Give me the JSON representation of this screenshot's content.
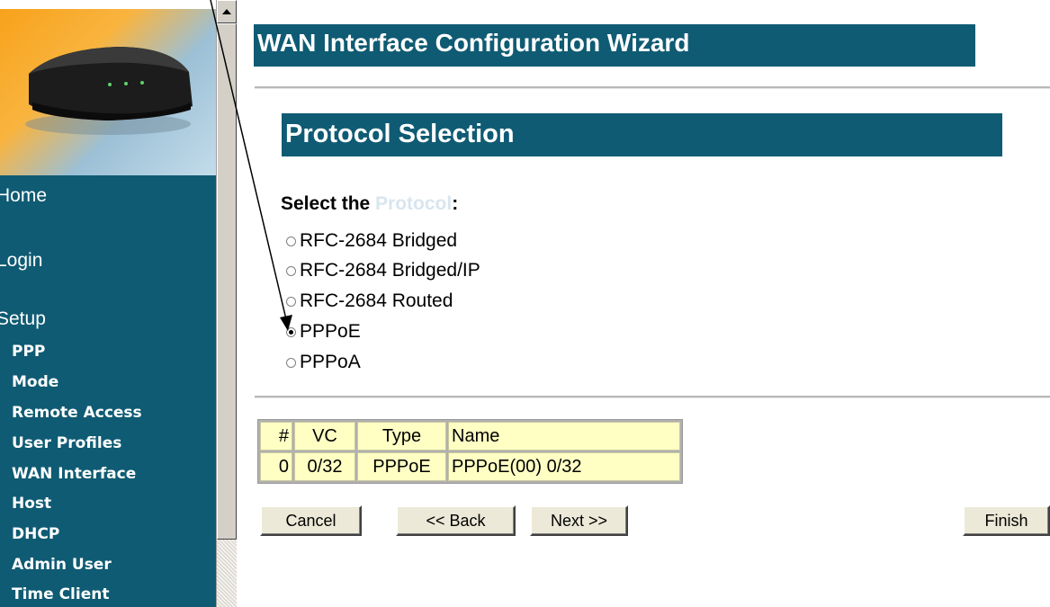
{
  "sidebar": {
    "main_items": [
      {
        "label": "Home"
      },
      {
        "label": "Login"
      },
      {
        "label": "Setup"
      }
    ],
    "sub_items": [
      {
        "label": "PPP"
      },
      {
        "label": "Mode"
      },
      {
        "label": "Remote Access"
      },
      {
        "label": "User Profiles"
      },
      {
        "label": "WAN Interface"
      },
      {
        "label": "Host"
      },
      {
        "label": "DHCP"
      },
      {
        "label": "Admin User"
      },
      {
        "label": "Time Client"
      }
    ]
  },
  "main": {
    "wizard_title": "WAN Interface Configuration Wizard",
    "section_title": "Protocol Selection",
    "prompt": {
      "prefix": "Select the ",
      "highlight": "Protocol",
      "suffix": ":"
    },
    "protocols": [
      {
        "label": "RFC-2684 Bridged",
        "checked": false
      },
      {
        "label": "RFC-2684 Bridged/IP",
        "checked": false
      },
      {
        "label": "RFC-2684 Routed",
        "checked": false
      },
      {
        "label": "PPPoE",
        "checked": true
      },
      {
        "label": "PPPoA",
        "checked": false
      }
    ],
    "table": {
      "headers": [
        "#",
        "VC",
        "Type",
        "Name"
      ],
      "rows": [
        [
          "0",
          "0/32",
          "PPPoE",
          "PPPoE(00) 0/32"
        ]
      ]
    },
    "buttons": {
      "cancel": "Cancel",
      "back": "<< Back",
      "next": "Next >>",
      "finish": "Finish"
    }
  },
  "colors": {
    "teal": "#0f5b73",
    "table_cell": "#ffffc4",
    "prompt_highlight": "#d8e6ee"
  }
}
